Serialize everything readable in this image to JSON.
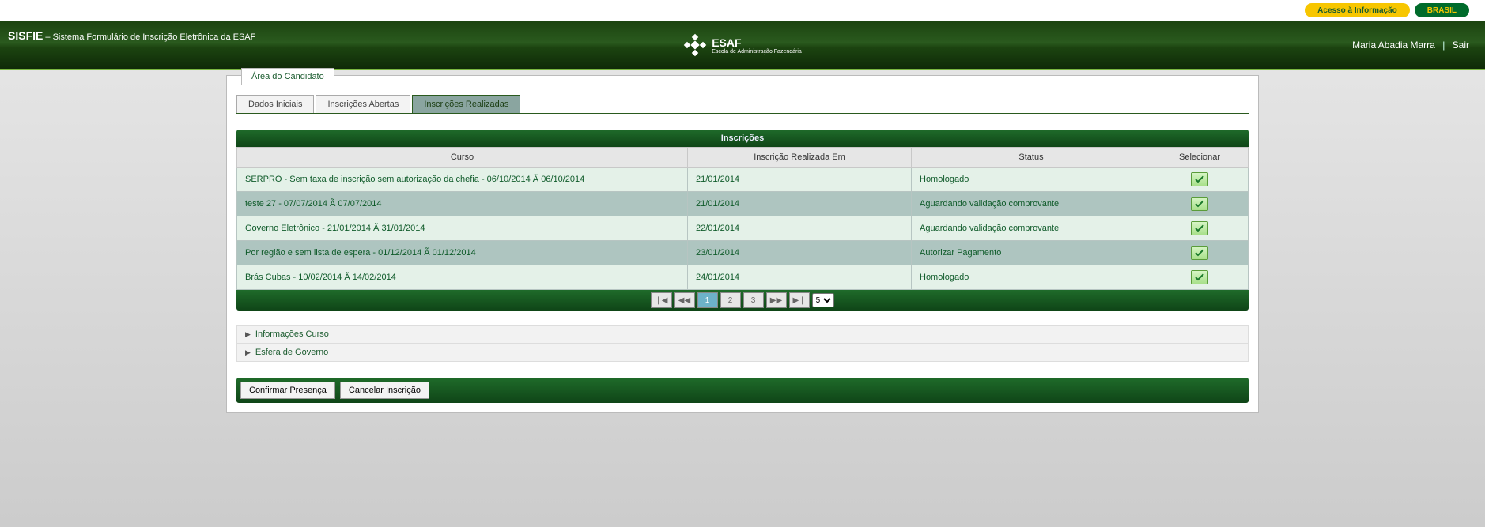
{
  "gov": {
    "acesso": "Acesso à Informação",
    "brasil": "BRASIL"
  },
  "header": {
    "sys_abbr": "SISFIE",
    "sys_desc": " – Sistema Formulário de Inscrição Eletrônica da ESAF",
    "logo_text": "ESAF",
    "logo_sub": "Escola de Administração Fazendária",
    "user_name": "Maria Abadia Marra",
    "logout": "Sair"
  },
  "fieldset_label": "Área do Candidato",
  "tabs": {
    "t0": "Dados Iniciais",
    "t1": "Inscrições Abertas",
    "t2": "Inscrições Realizadas"
  },
  "table": {
    "title": "Inscrições",
    "headers": {
      "curso": "Curso",
      "data": "Inscrição Realizada Em",
      "status": "Status",
      "sel": "Selecionar"
    },
    "rows": [
      {
        "curso": "SERPRO - Sem taxa de inscrição sem autorização da chefia - 06/10/2014 Ã  06/10/2014",
        "data": "21/01/2014",
        "status": "Homologado"
      },
      {
        "curso": "teste 27 - 07/07/2014 Ã  07/07/2014",
        "data": "21/01/2014",
        "status": "Aguardando validação comprovante"
      },
      {
        "curso": "Governo Eletrônico - 21/01/2014 Ã  31/01/2014",
        "data": "22/01/2014",
        "status": "Aguardando validação comprovante"
      },
      {
        "curso": "Por região e sem lista de espera - 01/12/2014 Ã  01/12/2014",
        "data": "23/01/2014",
        "status": "Autorizar Pagamento"
      },
      {
        "curso": "Brás Cubas - 10/02/2014 Ã  14/02/2014",
        "data": "24/01/2014",
        "status": "Homologado"
      }
    ]
  },
  "pager": {
    "first": "⏮",
    "prev": "◀◀",
    "p1": "1",
    "p2": "2",
    "p3": "3",
    "next": "▶▶",
    "last": "⏭",
    "size": "5"
  },
  "accordion": {
    "a0": "Informações Curso",
    "a1": "Esfera de Governo"
  },
  "actions": {
    "confirmar": "Confirmar Presença",
    "cancelar": "Cancelar Inscrição"
  }
}
